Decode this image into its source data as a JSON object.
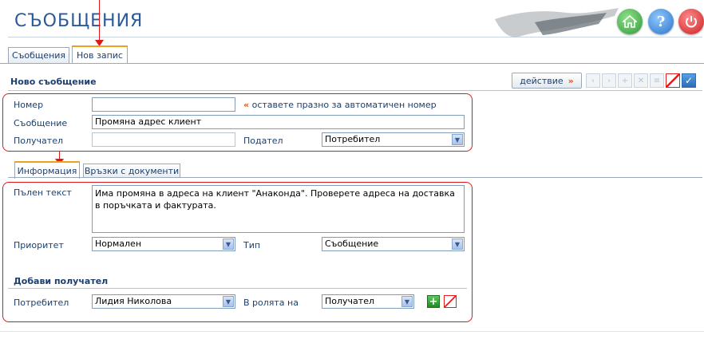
{
  "header": {
    "title": "СЪОБЩЕНИЯ",
    "icons": [
      "home-icon",
      "help-icon",
      "power-icon"
    ],
    "help_glyph": "?"
  },
  "top_tabs": [
    {
      "label": "Съобщения",
      "active": false
    },
    {
      "label": "Нов запис",
      "active": true
    }
  ],
  "section_title": "Ново съобщение",
  "toolbar": {
    "action_label": "действие",
    "action_chevron": "»",
    "nav_glyphs": [
      "‹",
      "›",
      "+",
      "✕",
      "≡"
    ]
  },
  "form": {
    "number_label": "Номер",
    "number_value": "",
    "hint_chevron": "«",
    "hint_text": "оставете празно за автоматичен номер",
    "message_label": "Съобщение",
    "message_value": "Промяна адрес клиент",
    "recipient_label": "Получател",
    "recipient_value": "",
    "sender_label": "Подател",
    "sender_value": "Потребител"
  },
  "inner_tabs": [
    {
      "label": "Информация",
      "active": true
    },
    {
      "label": "Връзки с документи",
      "active": false
    }
  ],
  "info": {
    "fulltext_label": "Пълен текст",
    "fulltext_value": "Има промяна в адреса на клиент \"Анаконда\". Проверете адреса на доставка в поръчката и фактурата.",
    "priority_label": "Приоритет",
    "priority_value": "Нормален",
    "type_label": "Тип",
    "type_value": "Съобщение",
    "add_recipient_title": "Добави получател",
    "user_label": "Потребител",
    "user_value": "Лидия Николова",
    "role_label": "В ролята на",
    "role_value": "Получател",
    "add_glyph": "+"
  },
  "colors": {
    "accent": "#1d3f6e",
    "highlight": "#e0181a",
    "tab_active_top": "#f0a020"
  }
}
